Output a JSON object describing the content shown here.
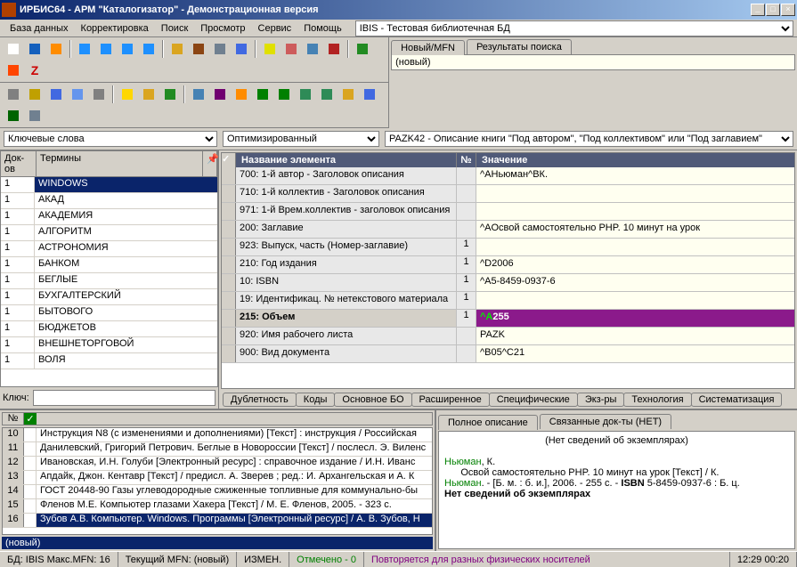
{
  "window": {
    "title": "ИРБИС64 - АРМ \"Каталогизатор\" - Демонстрационная версия"
  },
  "menu": [
    "База данных",
    "Корректировка",
    "Поиск",
    "Просмотр",
    "Сервис",
    "Помощь"
  ],
  "db_select": "IBIS - Тестовая библиотечная БД",
  "right_tabs": [
    "Новый/MFN",
    "Результаты поиска"
  ],
  "right_tab_content": "(новый)",
  "combo1": "Ключевые слова",
  "combo2": "Оптимизированный",
  "combo3": "PAZK42 - Описание книги \"Под автором\", \"Под коллективом\" или \"Под заглавием\"",
  "termgrid": {
    "headers": [
      "Док-ов",
      "Термины"
    ],
    "rows": [
      {
        "n": "1",
        "t": "WINDOWS",
        "sel": true
      },
      {
        "n": "1",
        "t": "АКАД"
      },
      {
        "n": "1",
        "t": "АКАДЕМИЯ"
      },
      {
        "n": "1",
        "t": "АЛГОРИТМ"
      },
      {
        "n": "1",
        "t": "АСТРОНОМИЯ"
      },
      {
        "n": "1",
        "t": "БАНКОМ"
      },
      {
        "n": "1",
        "t": "БЕГЛЫЕ"
      },
      {
        "n": "1",
        "t": "БУХГАЛТЕРСКИЙ"
      },
      {
        "n": "1",
        "t": "БЫТОВОГО"
      },
      {
        "n": "1",
        "t": "БЮДЖЕТОВ"
      },
      {
        "n": "1",
        "t": "ВНЕШНЕТОРГОВОЙ"
      },
      {
        "n": "1",
        "t": "ВОЛЯ"
      }
    ]
  },
  "key_label": "Ключ:",
  "fieldgrid": {
    "headers": [
      "",
      "Название элемента",
      "№",
      "Значение"
    ],
    "rows": [
      {
        "label": "700: 1-й  автор - Заголовок описания",
        "n": "",
        "val": "^AНьюман^BК."
      },
      {
        "label": "710: 1-й коллектив - Заголовок описания",
        "n": "",
        "val": ""
      },
      {
        "label": "971: 1-й Врем.коллектив - заголовок описания",
        "n": "",
        "val": ""
      },
      {
        "label": "200: Заглавие",
        "n": "",
        "val": "^AОсвой самостоятельно PHP. 10 минут на урок"
      },
      {
        "label": "923: Выпуск, часть (Номер-заглавие)",
        "n": "1",
        "val": ""
      },
      {
        "label": "210: Год издания",
        "n": "1",
        "val": "^D2006"
      },
      {
        "label": "10: ISBN",
        "n": "1",
        "val": "^A5-8459-0937-6"
      },
      {
        "label": "19: Идентификац. № нетекстового материала",
        "n": "1",
        "val": ""
      },
      {
        "label": "215: Объем",
        "n": "1",
        "val": "^A255",
        "hl": true
      },
      {
        "label": "920: Имя рабочего листа",
        "n": "",
        "val": "PAZK"
      },
      {
        "label": "900: Вид документа",
        "n": "",
        "val": "^B05^C21"
      }
    ]
  },
  "bottom_tabs": [
    "Дублетность",
    "Коды",
    "Основное БО",
    "Расширенное",
    "Специфические",
    "Экз-ры",
    "Технология",
    "Систематизация"
  ],
  "recgrid": {
    "rows": [
      {
        "n": "10",
        "t": "Инструкция N8  (с изменениями и дополнениями) [Текст] : инструкция / Российская"
      },
      {
        "n": "11",
        "t": "Данилевский, Григорий Петрович. Беглые в Новороссии [Текст] / послесл. Э. Виленс"
      },
      {
        "n": "12",
        "t": "Ивановская, И.Н. Голуби [Электронный ресурс] : справочное издание / И.Н. Иванс"
      },
      {
        "n": "13",
        "t": "Апдайк, Джон. Кентавр [Текст] / предисл. А. Зверев ; ред.: И. Архангельская и А. К"
      },
      {
        "n": "14",
        "t": "ГОСТ 20448-90 Газы углеводородные сжиженные топливные для коммунально-бы"
      },
      {
        "n": "15",
        "t": "Фленов М.Е. Компьютер глазами Хакера [Текст] / М. Е. Фленов, 2005. - 323 с."
      },
      {
        "n": "16",
        "t": "Зубов А.В. Компьютер. Windows. Программы [Электронный ресурс] / А. В. Зубов, Н",
        "sel": true
      }
    ],
    "footer": "(новый)"
  },
  "desc_tabs": [
    "Полное описание",
    "Связанные док-ты (НЕТ)"
  ],
  "desc": {
    "noitems": "(Нет сведений об экземплярах)",
    "line1_a": "Ньюман",
    "line1_b": ", К.",
    "line2": "Освой самостоятельно PHP. 10 минут на урок [Текст] / К.",
    "line3_a": "Ньюман",
    "line3_dot": ". - [Б. м. : б. и.], 2006. - 255 с. - ",
    "line3_isbn_l": "ISBN",
    "line3_isbn": " 5-8459-0937-6 : Б. ц.",
    "line4": "Нет сведений об экземплярах"
  },
  "status": {
    "db": "БД: IBIS Макс.MFN: 16",
    "mfn": "Текущий MFN: (новый)",
    "mod": "ИЗМЕН.",
    "marked": "Отмечено - 0",
    "msg": "Повторяется для разных физических носителей",
    "time": "12:29  00:20"
  }
}
